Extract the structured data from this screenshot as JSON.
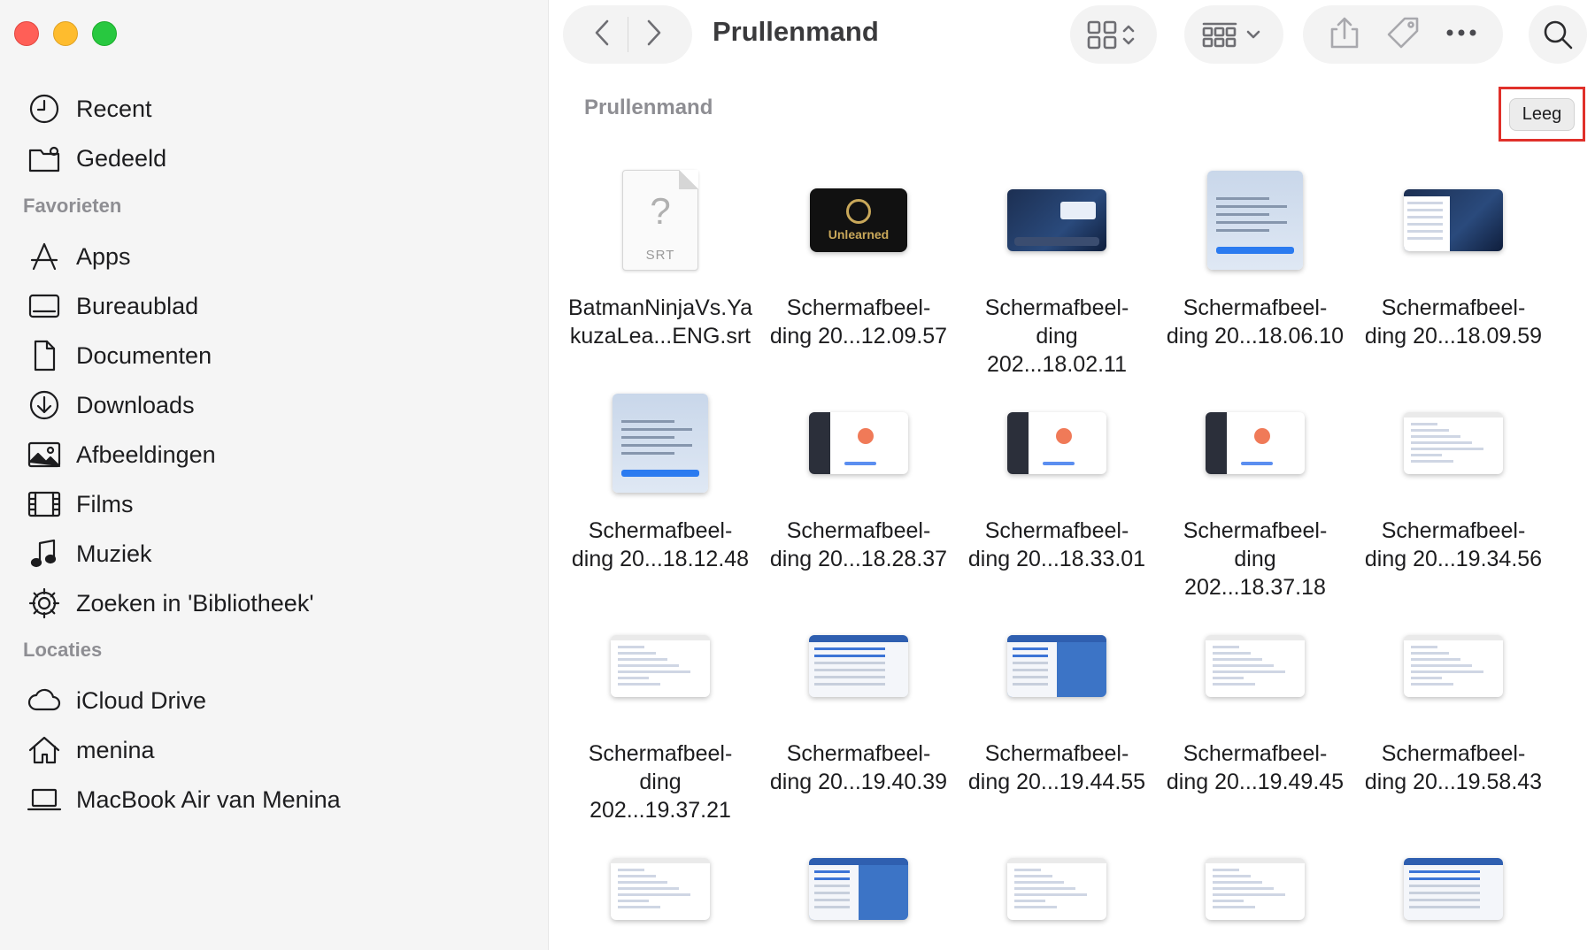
{
  "window": {
    "title": "Prullenmand"
  },
  "sidebar": {
    "recents": [
      {
        "label": "Recent",
        "icon": "clock-icon"
      },
      {
        "label": "Gedeeld",
        "icon": "shared-folder-icon"
      }
    ],
    "favorites_header": "Favorieten",
    "favorites": [
      {
        "label": "Apps",
        "icon": "apps-icon"
      },
      {
        "label": "Bureaublad",
        "icon": "desktop-icon"
      },
      {
        "label": "Documenten",
        "icon": "document-icon"
      },
      {
        "label": "Downloads",
        "icon": "download-icon"
      },
      {
        "label": "Afbeeldingen",
        "icon": "photo-icon"
      },
      {
        "label": "Films",
        "icon": "film-icon"
      },
      {
        "label": "Muziek",
        "icon": "music-icon"
      },
      {
        "label": "Zoeken in 'Bibliotheek'",
        "icon": "gear-icon"
      }
    ],
    "locations_header": "Locaties",
    "locations": [
      {
        "label": "iCloud Drive",
        "icon": "cloud-icon"
      },
      {
        "label": "menina",
        "icon": "home-icon"
      },
      {
        "label": "MacBook Air van Menina",
        "icon": "laptop-icon"
      }
    ]
  },
  "content": {
    "section_title": "Prullenmand",
    "empty_button": "Leeg",
    "files": [
      {
        "name": "BatmanNinjaVs.Ya\nkuzaLea...ENG.srt",
        "kind": "srt",
        "ext": "SRT"
      },
      {
        "name": "Schermafbeel-\nding 20...12.09.57",
        "kind": "unlearned",
        "thumb_text": "Unlearned"
      },
      {
        "name": "Schermafbeel-\nding 202...18.02.11",
        "kind": "dark"
      },
      {
        "name": "Schermafbeel-\nding 20...18.06.10",
        "kind": "tall"
      },
      {
        "name": "Schermafbeel-\nding 20...18.09.59",
        "kind": "dark-list"
      },
      {
        "name": "Schermafbeel-\nding 20...18.12.48",
        "kind": "tall"
      },
      {
        "name": "Schermafbeel-\nding 20...18.28.37",
        "kind": "restart"
      },
      {
        "name": "Schermafbeel-\nding 20...18.33.01",
        "kind": "restart"
      },
      {
        "name": "Schermafbeel-\nding 202...18.37.18",
        "kind": "restart"
      },
      {
        "name": "Schermafbeel-\nding 20...19.34.56",
        "kind": "list"
      },
      {
        "name": "Schermafbeel-\nding 202...19.37.21",
        "kind": "list"
      },
      {
        "name": "Schermafbeel-\nding 20...19.40.39",
        "kind": "blue"
      },
      {
        "name": "Schermafbeel-\nding 20...19.44.55",
        "kind": "blue-split"
      },
      {
        "name": "Schermafbeel-\nding 20...19.49.45",
        "kind": "list"
      },
      {
        "name": "Schermafbeel-\nding 20...19.58.43",
        "kind": "list"
      },
      {
        "name": "",
        "kind": "list"
      },
      {
        "name": "",
        "kind": "blue-split"
      },
      {
        "name": "",
        "kind": "list"
      },
      {
        "name": "",
        "kind": "list"
      },
      {
        "name": "",
        "kind": "blue"
      }
    ]
  }
}
